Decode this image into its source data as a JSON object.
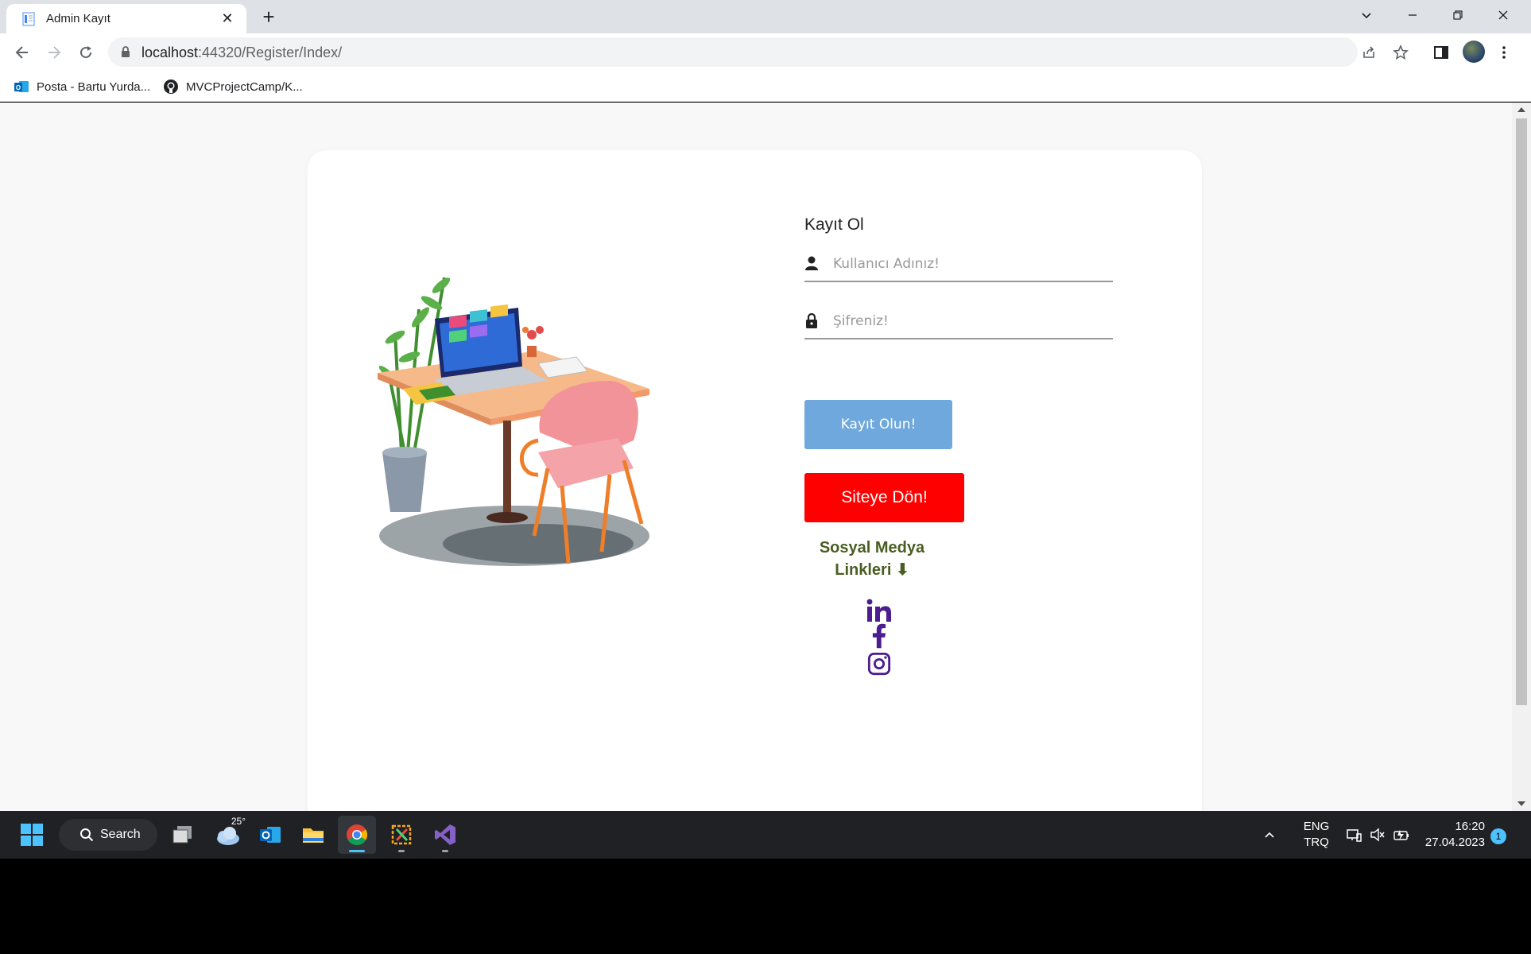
{
  "browser": {
    "tab_title": "Admin Kayıt",
    "tab_close": "✕",
    "new_tab": "+",
    "url_host": "localhost",
    "url_rest": ":44320/Register/Index/",
    "bookmarks": [
      {
        "label": "Posta - Bartu Yurda..."
      },
      {
        "label": "MVCProjectCamp/K..."
      }
    ]
  },
  "page": {
    "form_title": "Kayıt Ol",
    "username_placeholder": "Kullanıcı Adınız!",
    "password_placeholder": "Şifreniz!",
    "register_button": "Kayıt Olun!",
    "back_button": "Siteye Dön!",
    "social_title_line1": "Sosyal Medya",
    "social_title_line2": "Linkleri ⬇",
    "social_links": [
      "linkedin",
      "facebook",
      "instagram"
    ]
  },
  "taskbar": {
    "search_label": "Search",
    "weather_temp": "25°",
    "lang_line1": "ENG",
    "lang_line2": "TRQ",
    "time": "16:20",
    "date": "27.04.2023",
    "notification_count": "1"
  },
  "colors": {
    "register_button": "#6fa8dc",
    "back_button": "#ff0000",
    "social_title": "#4a5e23",
    "social_icons": "#4b1d8f"
  }
}
